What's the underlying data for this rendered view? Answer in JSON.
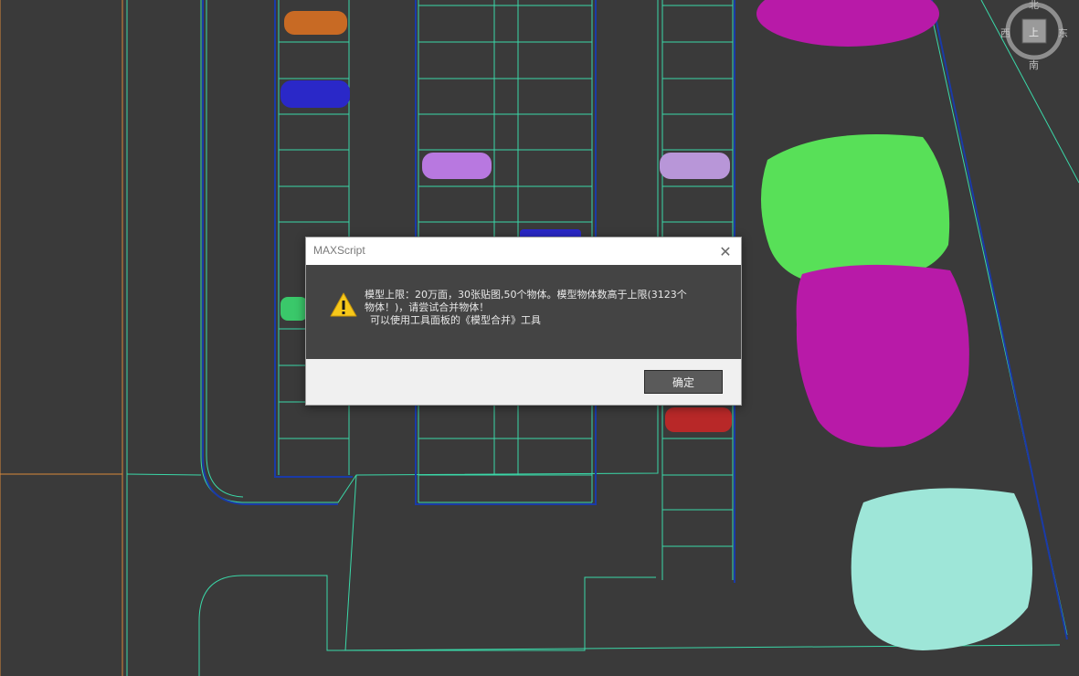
{
  "dialog": {
    "title": "MAXScript",
    "message_line1": "模型上限：20万面，30张贴图,50个物体。模型物体数高于上限(3123个",
    "message_line2": "物体！)，请尝试合并物体！",
    "message_line3": "可以使用工具面板的《模型合并》工具",
    "ok_label": "确定",
    "close_glyph": "✕"
  },
  "viewcube": {
    "north": "北",
    "south": "南",
    "east": "东",
    "west": "西",
    "face": "上"
  },
  "colors": {
    "viewport_bg": "#3a3a3a",
    "line_cyan": "#3ad8a8",
    "line_blue": "#1a3aa8",
    "tree_magenta": "#b81aa8",
    "tree_green": "#5ae05a",
    "tree_cyan": "#9ee6d8"
  }
}
